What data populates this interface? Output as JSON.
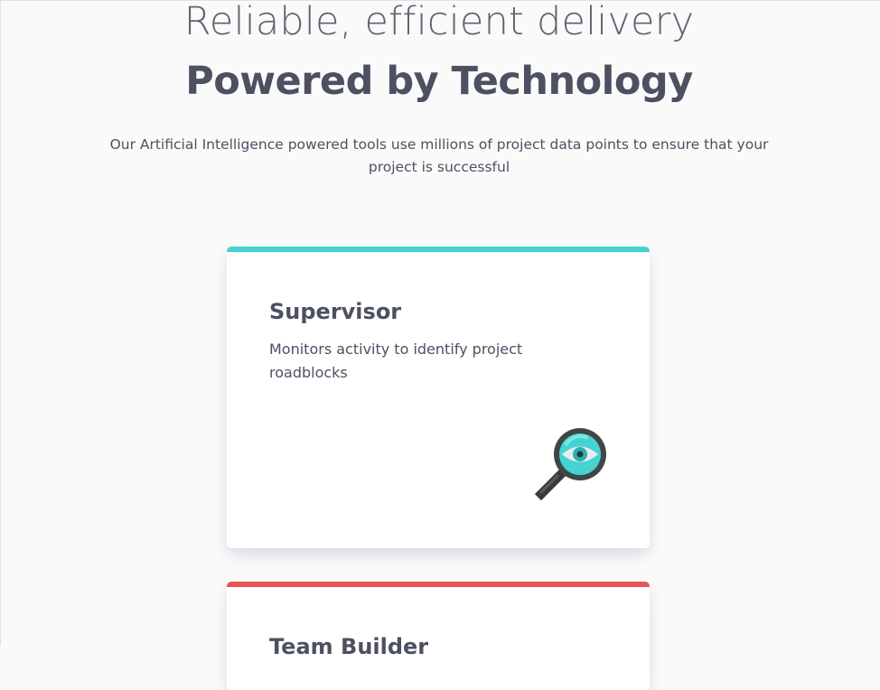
{
  "hero": {
    "subtitle": "Reliable, efficient delivery",
    "title": "Powered by Technology",
    "description": "Our Artificial Intelligence powered tools use millions of project data points to ensure that your project is successful"
  },
  "cards": [
    {
      "title": "Supervisor",
      "description": "Monitors activity to identify project roadblocks",
      "accent_color": "#44d3d2",
      "icon": "supervisor-magnifier-eye-icon"
    },
    {
      "title": "Team Builder",
      "description": "",
      "accent_color": "#ea5454",
      "icon": ""
    }
  ]
}
